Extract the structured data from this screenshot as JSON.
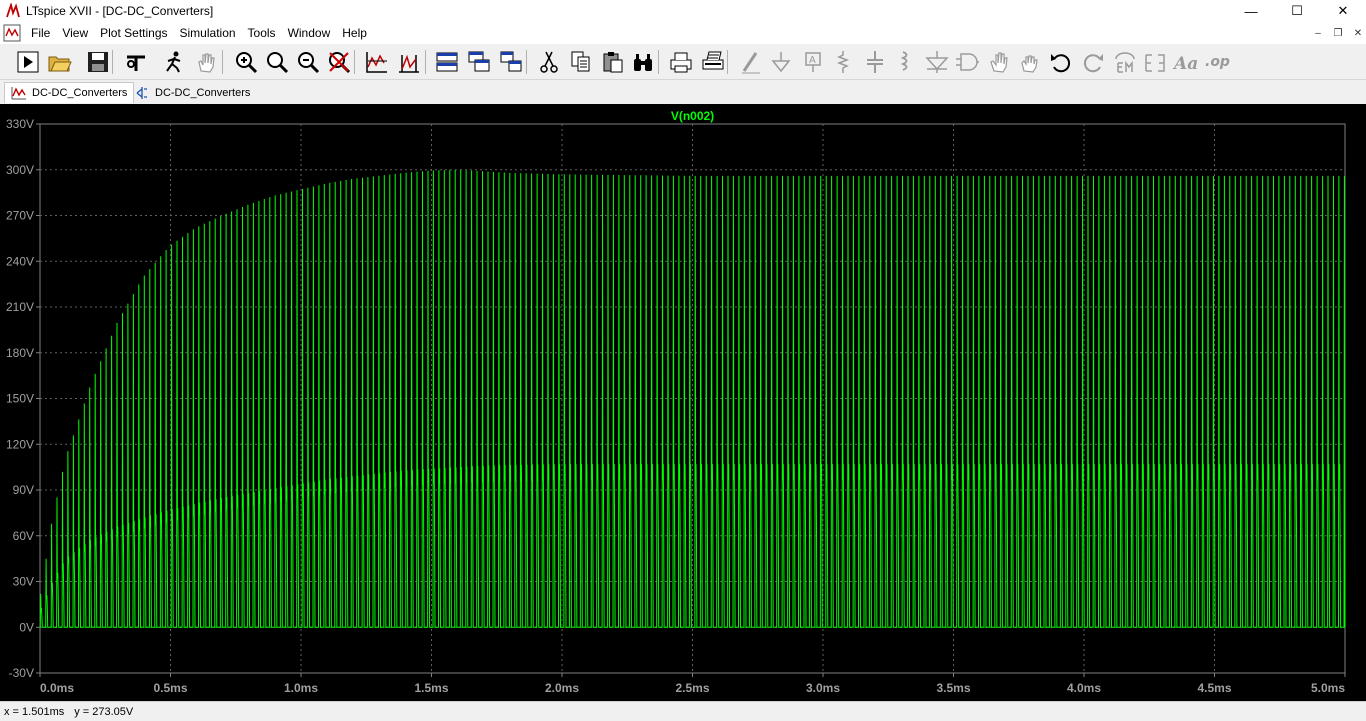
{
  "window": {
    "title": "LTspice XVII - [DC-DC_Converters]",
    "minimize_glyph": "—",
    "maximize_glyph": "☐",
    "close_glyph": "✕"
  },
  "menu": {
    "items": [
      "File",
      "View",
      "Plot Settings",
      "Simulation",
      "Tools",
      "Window",
      "Help"
    ],
    "mdi_minimize": "–",
    "mdi_restore": "❐",
    "mdi_close": "✕"
  },
  "toolbar": {
    "buttons": [
      {
        "name": "run-icon"
      },
      {
        "name": "open-folder-icon"
      },
      {
        "name": "save-icon"
      },
      {
        "name": "control-panel-icon"
      },
      {
        "name": "halt-icon"
      },
      {
        "name": "pan-hand-icon"
      },
      {
        "name": "zoom-in-icon"
      },
      {
        "name": "zoom-area-icon"
      },
      {
        "name": "zoom-out-icon"
      },
      {
        "name": "zoom-cancel-icon"
      },
      {
        "name": "autorange-icon"
      },
      {
        "name": "fft-icon"
      },
      {
        "name": "tile-horizontal-icon"
      },
      {
        "name": "cascade-icon"
      },
      {
        "name": "tile-vertical-icon"
      },
      {
        "name": "cut-icon"
      },
      {
        "name": "copy-icon"
      },
      {
        "name": "paste-icon"
      },
      {
        "name": "find-icon"
      },
      {
        "name": "print-icon"
      },
      {
        "name": "print-setup-icon"
      },
      {
        "name": "draw-wire-icon"
      },
      {
        "name": "ground-icon"
      },
      {
        "name": "label-net-icon"
      },
      {
        "name": "resistor-icon"
      },
      {
        "name": "capacitor-icon"
      },
      {
        "name": "inductor-icon"
      },
      {
        "name": "diode-icon"
      },
      {
        "name": "component-icon"
      },
      {
        "name": "move-hand-icon"
      },
      {
        "name": "drag-hand-icon"
      },
      {
        "name": "undo-icon"
      },
      {
        "name": "redo-icon"
      },
      {
        "name": "rotate-icon"
      },
      {
        "name": "mirror-icon"
      },
      {
        "name": "text-icon"
      },
      {
        "name": "spice-directive-icon"
      }
    ]
  },
  "tabs": [
    {
      "label": "DC-DC_Converters",
      "kind": "waveform"
    },
    {
      "label": "DC-DC_Converters",
      "kind": "schematic"
    }
  ],
  "chart_data": {
    "type": "line",
    "title": "V(n002)",
    "xlabel": "",
    "ylabel": "",
    "xlim": [
      0,
      5.0
    ],
    "ylim": [
      -30,
      330
    ],
    "x_unit": "ms",
    "y_unit": "V",
    "x_ticks": [
      "0.0ms",
      "0.5ms",
      "1.0ms",
      "1.5ms",
      "2.0ms",
      "2.5ms",
      "3.0ms",
      "3.5ms",
      "4.0ms",
      "4.5ms",
      "5.0ms"
    ],
    "y_ticks": [
      "330V",
      "300V",
      "270V",
      "240V",
      "210V",
      "180V",
      "150V",
      "120V",
      "90V",
      "60V",
      "30V",
      "0V",
      "-30V"
    ],
    "grid": true,
    "background": "#000000",
    "trace_color": "#00ff00",
    "axis_color": "#808080",
    "tick_label_color": "#a0a0a0",
    "series": [
      {
        "name": "V(n002)",
        "pulse_period_ms": 0.0209,
        "peak_envelope": {
          "x": [
            0.0,
            0.05,
            0.1,
            0.2,
            0.3,
            0.4,
            0.5,
            0.6,
            0.7,
            0.8,
            0.9,
            1.0,
            1.1,
            1.2,
            1.3,
            1.4,
            1.5,
            1.6,
            1.7,
            1.8,
            2.0,
            2.5,
            3.0,
            3.5,
            4.0,
            4.5,
            5.0
          ],
          "y": [
            15,
            70,
            110,
            160,
            200,
            230,
            250,
            262,
            270,
            277,
            283,
            287,
            291,
            294,
            296,
            298,
            299.5,
            300,
            299,
            298,
            297,
            296,
            296,
            296,
            296,
            296,
            296
          ]
        },
        "secondary_envelope": {
          "x": [
            0.0,
            0.05,
            0.1,
            0.2,
            0.3,
            0.4,
            0.5,
            0.6,
            0.7,
            0.8,
            0.9,
            1.0,
            1.1,
            1.2,
            1.3,
            1.4,
            1.5,
            1.6,
            1.7,
            1.8,
            2.0,
            2.5,
            3.0,
            3.5,
            4.0,
            4.5,
            5.0
          ],
          "y": [
            10,
            30,
            45,
            58,
            66,
            72,
            77,
            81,
            85,
            88,
            91,
            94,
            97,
            99,
            101,
            103,
            104,
            105,
            106,
            106.5,
            107,
            107,
            107,
            107,
            107,
            107,
            107
          ]
        },
        "baseline": 0
      }
    ]
  },
  "status": {
    "x_readout": "x = 1.501ms",
    "y_readout": "y = 273.05V"
  }
}
